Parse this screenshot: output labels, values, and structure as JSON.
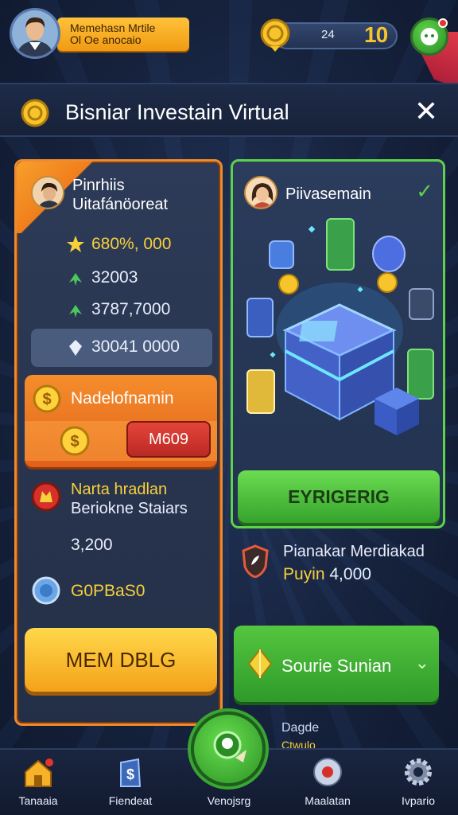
{
  "header": {
    "username_line1": "Memehasn Mrtile",
    "username_line2": "Ol Oe anocaio",
    "coin_count": "24",
    "level": "10"
  },
  "title_bar": {
    "title": "Bisniar Investain Virtual"
  },
  "left_panel": {
    "title_line1": "Pinrhiis",
    "title_line2": "Uitafánöoreat",
    "stats": [
      {
        "icon": "star-icon",
        "value": "680%, 000"
      },
      {
        "icon": "arrow-icon",
        "value": "32003"
      },
      {
        "icon": "arrow-icon",
        "value": "3787,7000"
      }
    ],
    "highlight_value": "30041 0000",
    "card_title": "Nadelofnamin",
    "card_button": "M609",
    "block_title": "Narta hradlan",
    "block_sub": "Beriokne Staiars",
    "amount": "3,200",
    "badge_text": "G0PBaS0",
    "main_button": "MEM DBLG"
  },
  "right_panel": {
    "title": "Piivasemain",
    "action_button": "EYRIGERIG",
    "info_title": "Pianakar Merdiakad",
    "info_sub_prefix": "Puyin",
    "info_sub_value": "4,000",
    "secondary_button": "Sourie Sunian"
  },
  "floating": {
    "label": "Dagde",
    "sub": "Ctwulo"
  },
  "nav": {
    "items": [
      {
        "label": "Tanaaia"
      },
      {
        "label": "Fiendeat"
      },
      {
        "label": "Venojsrg"
      },
      {
        "label": "Maalatan"
      },
      {
        "label": "Ivpario"
      }
    ]
  },
  "colors": {
    "accent_orange": "#f08a2b",
    "accent_green": "#5fd14b",
    "gold": "#f8d03b",
    "background": "#16223d"
  }
}
